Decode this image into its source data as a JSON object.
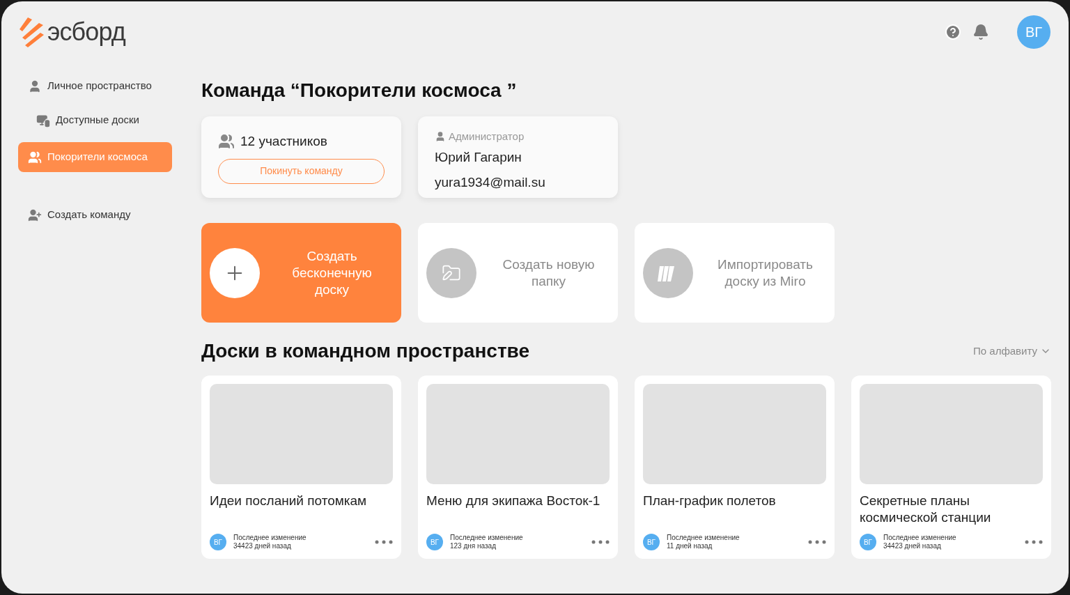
{
  "logo": {
    "text": "эсборд"
  },
  "header": {
    "avatar": "ВГ"
  },
  "sidebar": {
    "items": [
      {
        "label": "Личное пространство",
        "kind": "person",
        "selected": false
      },
      {
        "label": "Доступные доски",
        "kind": "boards",
        "selected": false
      },
      {
        "label": "Покорители космоса",
        "kind": "team",
        "selected": true
      },
      {
        "label": "Создать команду",
        "kind": "add-person",
        "selected": false
      }
    ]
  },
  "title": "Команда “Покорители космоса ”",
  "members_card": {
    "count": "12 участников",
    "leave_button": "Покинуть команду"
  },
  "admin_card": {
    "role": "Администратор",
    "name": "Юрий Гагарин",
    "email": "yura1934@mail.su"
  },
  "actions": [
    {
      "label": "Создать бесконечную доску",
      "kind": "plus",
      "selected": true
    },
    {
      "label": "Создать новую папку",
      "kind": "folder",
      "selected": false
    },
    {
      "label": "Импортировать доску из Miro",
      "kind": "miro",
      "selected": false
    }
  ],
  "boards_section": {
    "title": "Доски в командном пространстве",
    "sort": "По алфавиту"
  },
  "boards": [
    {
      "title": "Идеи посланий потомкам",
      "avatar": "ВГ",
      "changed_label": "Последнее изменение",
      "changed_ago": "34423 дней назад"
    },
    {
      "title": "Меню для экипажа Восток-1",
      "avatar": "ВГ",
      "changed_label": "Последнее изменение",
      "changed_ago": "123 дня назад"
    },
    {
      "title": "План-график полетов",
      "avatar": "ВГ",
      "changed_label": "Последнее изменение",
      "changed_ago": "11 дней назад"
    },
    {
      "title": "Секретные планы космической станции",
      "avatar": "ВГ",
      "changed_label": "Последнее изменение",
      "changed_ago": "34423 дней назад"
    }
  ]
}
